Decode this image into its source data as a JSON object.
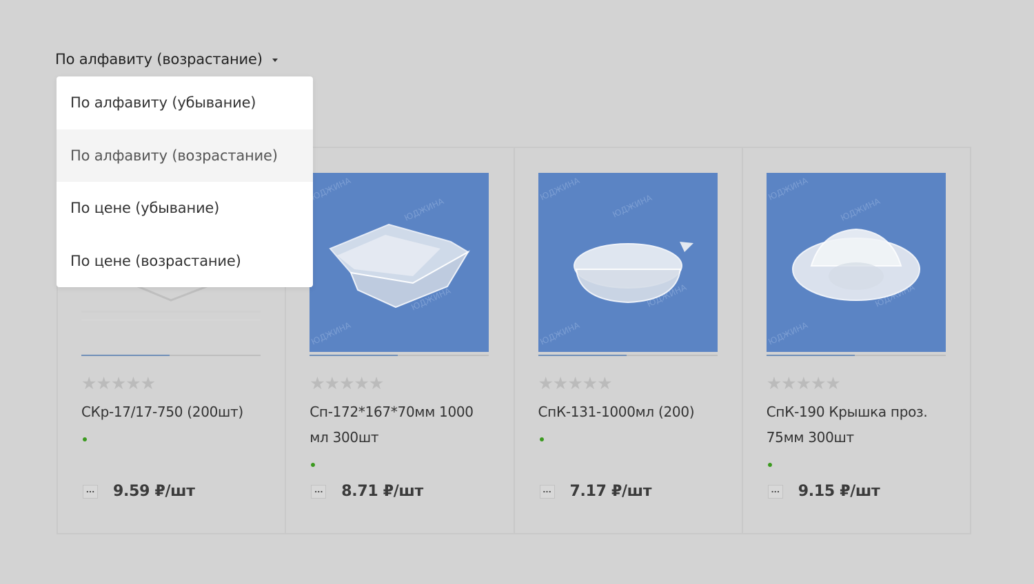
{
  "sort": {
    "current": "По алфавиту (возрастание)",
    "options": [
      "По алфавиту (убывание)",
      "По алфавиту (возрастание)",
      "По цене (убывание)",
      "По цене (возрастание)"
    ],
    "active_index": 1
  },
  "products": [
    {
      "name": "СКр-17/17-750 (200шт)",
      "price": "9.59 ₽/шт",
      "stars": "★★★★★",
      "more": "...",
      "in_stock_color": "#3b9a1f"
    },
    {
      "name": "Сп-172*167*70мм 1000 мл 300шт",
      "price": "8.71 ₽/шт",
      "stars": "★★★★★",
      "more": "...",
      "in_stock_color": "#3b9a1f"
    },
    {
      "name": "СпК-131-1000мл (200)",
      "price": "7.17 ₽/шт",
      "stars": "★★★★★",
      "more": "...",
      "in_stock_color": "#3b9a1f"
    },
    {
      "name": "СпК-190 Крышка проз. 75мм 300шт",
      "price": "9.15 ₽/шт",
      "stars": "★★★★★",
      "more": "...",
      "in_stock_color": "#3b9a1f"
    }
  ],
  "watermark": "ЮДЖИНА",
  "colors": {
    "background": "#d3d3d3",
    "image_bg": "#5b84c4",
    "stock_dot": "#3b9a1f"
  }
}
